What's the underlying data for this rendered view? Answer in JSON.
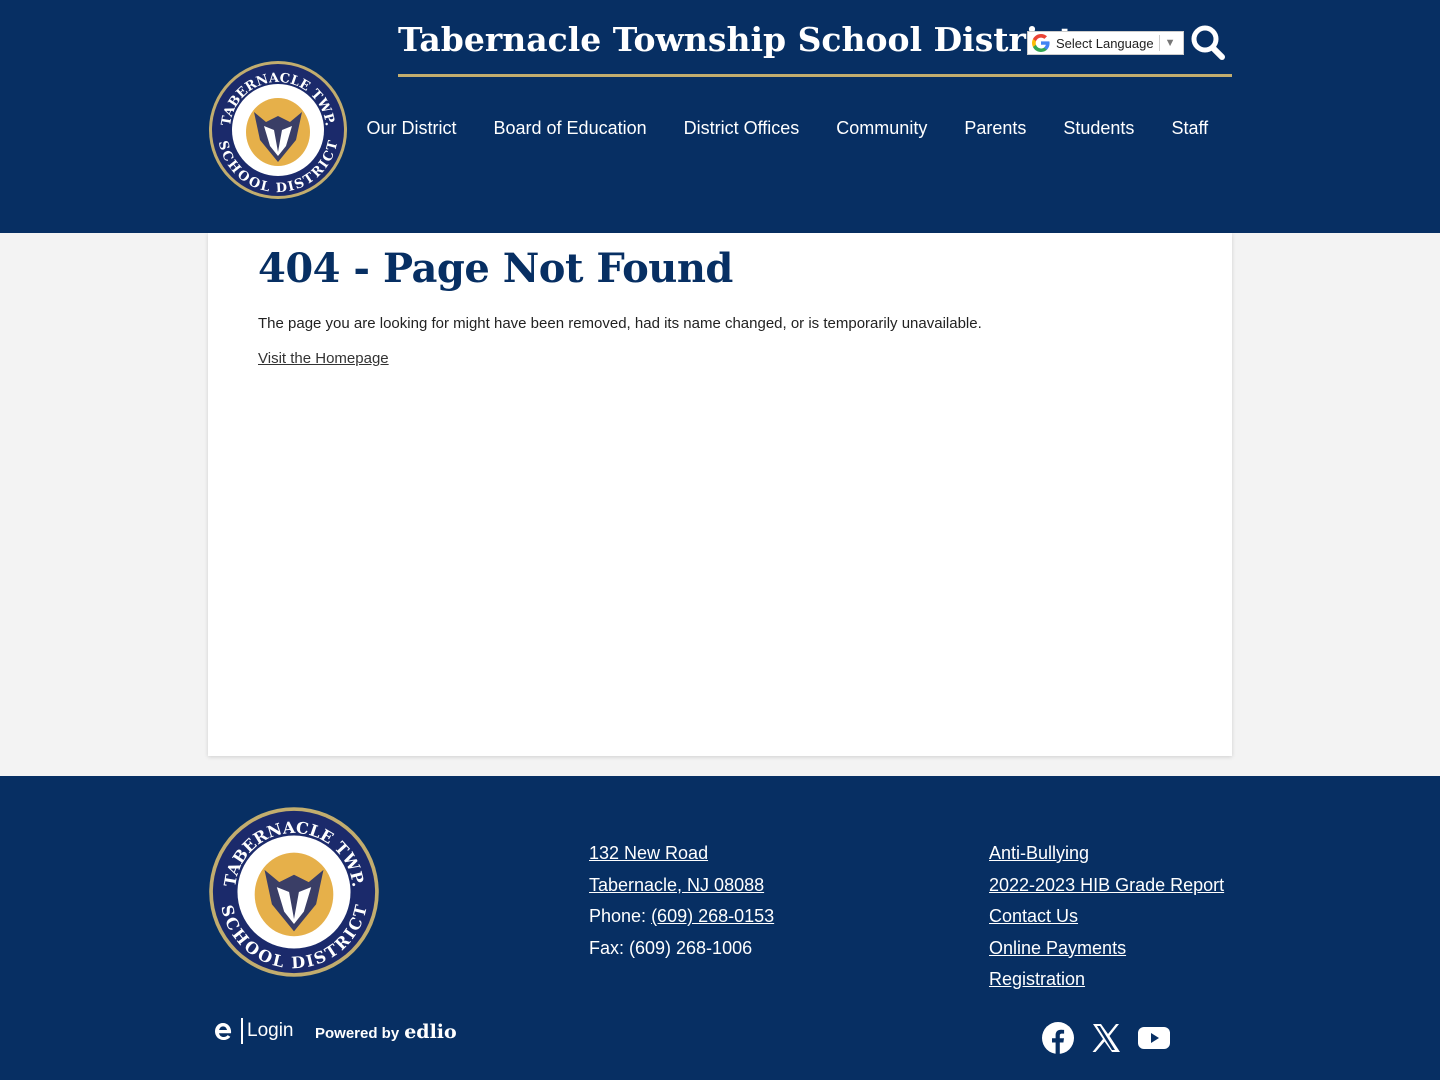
{
  "header": {
    "site_title": "Tabernacle Township School District",
    "logo_alt": "Tabernacle Twp. School District logo",
    "language_select": {
      "selected": "Select Language",
      "icon": "google-translate-icon"
    },
    "search_icon": "search-icon",
    "nav": [
      {
        "label": "Our District"
      },
      {
        "label": "Board of Education"
      },
      {
        "label": "District Offices"
      },
      {
        "label": "Community"
      },
      {
        "label": "Parents"
      },
      {
        "label": "Students"
      },
      {
        "label": "Staff"
      }
    ]
  },
  "main": {
    "title": "404 - Page Not Found",
    "message": "The page you are looking for might have been removed, had its name changed, or is temporarily unavailable.",
    "home_link": "Visit the Homepage"
  },
  "footer": {
    "address_line1": "132 New Road",
    "address_line2": "Tabernacle, NJ 08088",
    "phone_label": "Phone: ",
    "phone": "(609) 268-0153",
    "fax": "Fax: (609) 268-1006",
    "links": [
      {
        "label": "Anti-Bullying"
      },
      {
        "label": "2022-2023 HIB Grade Report"
      },
      {
        "label": "Contact Us"
      },
      {
        "label": "Online Payments"
      },
      {
        "label": "Registration"
      }
    ],
    "login_label": "Login",
    "powered_by": "Powered by",
    "powered_brand": "edlio",
    "social": [
      "facebook-icon",
      "x-icon",
      "youtube-icon"
    ]
  },
  "colors": {
    "primary": "#072f63",
    "accent": "#c2ad6e",
    "background": "#f3f3f3"
  }
}
